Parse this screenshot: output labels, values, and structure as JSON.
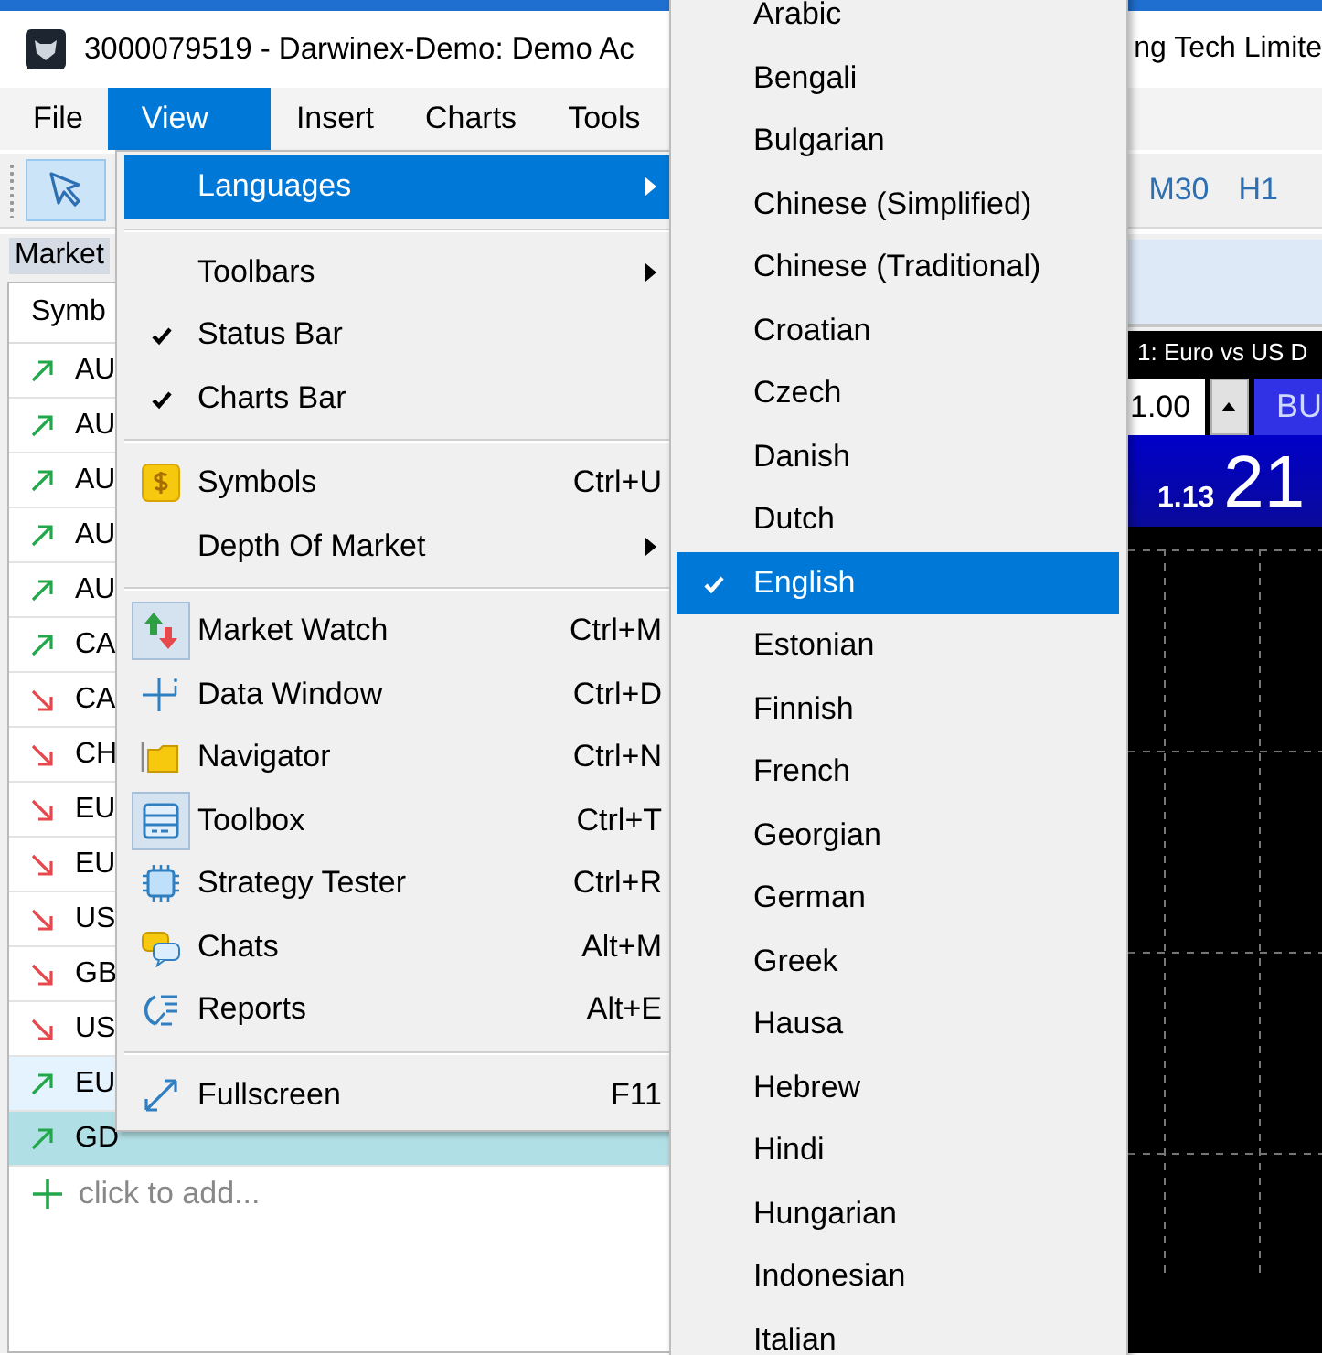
{
  "window": {
    "title_left": "3000079519 - Darwinex-Demo: Demo Ac",
    "title_right": "ng Tech Limite"
  },
  "menubar": [
    {
      "label": "File",
      "selected": false
    },
    {
      "label": "View",
      "selected": true
    },
    {
      "label": "Insert",
      "selected": false
    },
    {
      "label": "Charts",
      "selected": false
    },
    {
      "label": "Tools",
      "selected": false
    }
  ],
  "toolbar": {
    "pointer_selected": true,
    "timeframes": [
      "M30",
      "H1"
    ]
  },
  "market_watch": {
    "tab": "Market",
    "column": "Symb",
    "rows": [
      {
        "symbol": "AU",
        "kind": "up",
        "selected": false,
        "hovered": false
      },
      {
        "symbol": "AU",
        "kind": "up",
        "selected": false,
        "hovered": false
      },
      {
        "symbol": "AU",
        "kind": "up",
        "selected": false,
        "hovered": false
      },
      {
        "symbol": "AU",
        "kind": "up",
        "selected": false,
        "hovered": false
      },
      {
        "symbol": "AU",
        "kind": "up",
        "selected": false,
        "hovered": false
      },
      {
        "symbol": "CA",
        "kind": "up",
        "selected": false,
        "hovered": false
      },
      {
        "symbol": "CA",
        "kind": "down",
        "selected": false,
        "hovered": false
      },
      {
        "symbol": "CH",
        "kind": "down",
        "selected": false,
        "hovered": false
      },
      {
        "symbol": "EU",
        "kind": "down",
        "selected": false,
        "hovered": false
      },
      {
        "symbol": "EU",
        "kind": "down",
        "selected": false,
        "hovered": false
      },
      {
        "symbol": "US",
        "kind": "down",
        "selected": false,
        "hovered": false
      },
      {
        "symbol": "GB",
        "kind": "down",
        "selected": false,
        "hovered": false
      },
      {
        "symbol": "US",
        "kind": "down",
        "selected": false,
        "hovered": false
      },
      {
        "symbol": "EU",
        "kind": "up",
        "selected": false,
        "hovered": true
      },
      {
        "symbol": "GD",
        "kind": "up",
        "selected": true,
        "hovered": false
      }
    ],
    "add_row": "click to add..."
  },
  "chart": {
    "title": "1: Euro vs US D",
    "lot": "1.00",
    "buy_label": "BU",
    "price_small": "1.13",
    "price_large": "21"
  },
  "view_menu": [
    {
      "kind": "item",
      "label": "Languages",
      "submenu": true,
      "checked": false,
      "selected": true
    },
    {
      "kind": "separator"
    },
    {
      "kind": "item",
      "label": "Toolbars",
      "submenu": true,
      "checked": false,
      "selected": false
    },
    {
      "kind": "item",
      "label": "Status Bar",
      "submenu": false,
      "checked": true,
      "selected": false
    },
    {
      "kind": "item",
      "label": "Charts Bar",
      "submenu": false,
      "checked": true,
      "selected": false
    },
    {
      "kind": "separator"
    },
    {
      "kind": "item",
      "label": "Symbols",
      "shortcut": "Ctrl+U",
      "submenu": false,
      "checked": false,
      "selected": false,
      "pressed": false
    },
    {
      "kind": "item",
      "label": "Depth Of Market",
      "submenu": true,
      "checked": false,
      "selected": false
    },
    {
      "kind": "separator"
    },
    {
      "kind": "item",
      "label": "Market Watch",
      "shortcut": "Ctrl+M",
      "submenu": false,
      "checked": false,
      "selected": false,
      "pressed": true
    },
    {
      "kind": "item",
      "label": "Data Window",
      "shortcut": "Ctrl+D",
      "submenu": false,
      "checked": false,
      "selected": false,
      "pressed": false
    },
    {
      "kind": "item",
      "label": "Navigator",
      "shortcut": "Ctrl+N",
      "submenu": false,
      "checked": false,
      "selected": false,
      "pressed": false
    },
    {
      "kind": "item",
      "label": "Toolbox",
      "shortcut": "Ctrl+T",
      "submenu": false,
      "checked": false,
      "selected": false,
      "pressed": true
    },
    {
      "kind": "item",
      "label": "Strategy Tester",
      "shortcut": "Ctrl+R",
      "submenu": false,
      "checked": false,
      "selected": false,
      "pressed": false
    },
    {
      "kind": "item",
      "label": "Chats",
      "shortcut": "Alt+M",
      "submenu": false,
      "checked": false,
      "selected": false,
      "pressed": false
    },
    {
      "kind": "item",
      "label": "Reports",
      "shortcut": "Alt+E",
      "submenu": false,
      "checked": false,
      "selected": false,
      "pressed": false
    },
    {
      "kind": "separator"
    },
    {
      "kind": "item",
      "label": "Fullscreen",
      "shortcut": "F11",
      "submenu": false,
      "checked": false,
      "selected": false,
      "pressed": false
    }
  ],
  "languages_menu": [
    {
      "label": "Arabic",
      "checked": false,
      "selected": false
    },
    {
      "label": "Bengali",
      "checked": false,
      "selected": false
    },
    {
      "label": "Bulgarian",
      "checked": false,
      "selected": false
    },
    {
      "label": "Chinese (Simplified)",
      "checked": false,
      "selected": false
    },
    {
      "label": "Chinese (Traditional)",
      "checked": false,
      "selected": false
    },
    {
      "label": "Croatian",
      "checked": false,
      "selected": false
    },
    {
      "label": "Czech",
      "checked": false,
      "selected": false
    },
    {
      "label": "Danish",
      "checked": false,
      "selected": false
    },
    {
      "label": "Dutch",
      "checked": false,
      "selected": false
    },
    {
      "label": "English",
      "checked": true,
      "selected": true
    },
    {
      "label": "Estonian",
      "checked": false,
      "selected": false
    },
    {
      "label": "Finnish",
      "checked": false,
      "selected": false
    },
    {
      "label": "French",
      "checked": false,
      "selected": false
    },
    {
      "label": "Georgian",
      "checked": false,
      "selected": false
    },
    {
      "label": "German",
      "checked": false,
      "selected": false
    },
    {
      "label": "Greek",
      "checked": false,
      "selected": false
    },
    {
      "label": "Hausa",
      "checked": false,
      "selected": false
    },
    {
      "label": "Hebrew",
      "checked": false,
      "selected": false
    },
    {
      "label": "Hindi",
      "checked": false,
      "selected": false
    },
    {
      "label": "Hungarian",
      "checked": false,
      "selected": false
    },
    {
      "label": "Indonesian",
      "checked": false,
      "selected": false
    },
    {
      "label": "Italian",
      "checked": false,
      "selected": false
    }
  ]
}
